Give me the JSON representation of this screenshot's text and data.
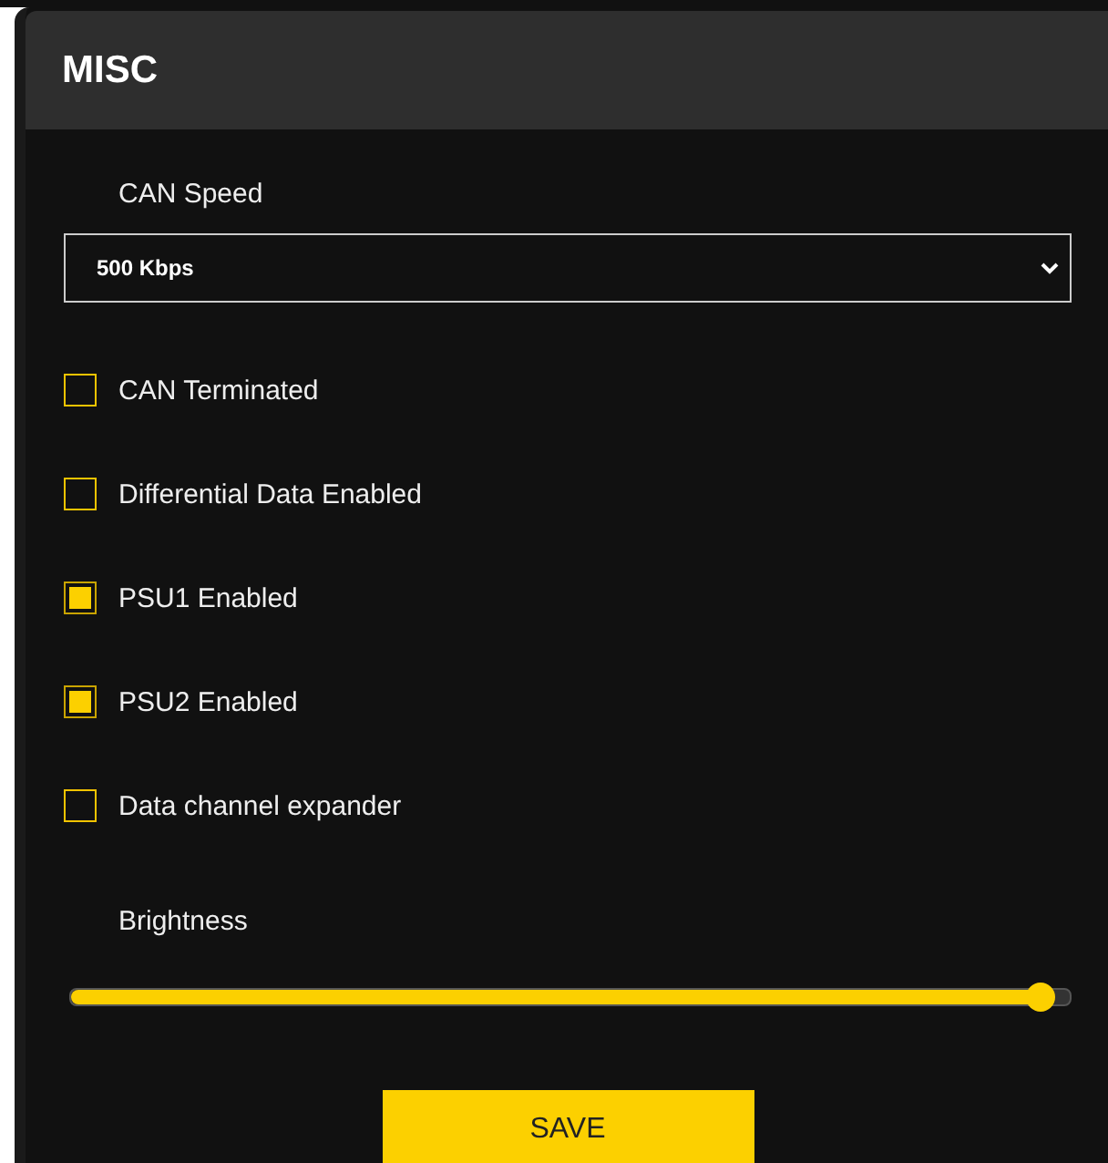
{
  "panel": {
    "title": "MISC"
  },
  "can_speed": {
    "label": "CAN Speed",
    "value": "500 Kbps"
  },
  "options": [
    {
      "label": "CAN Terminated",
      "checked": false
    },
    {
      "label": "Differential Data Enabled",
      "checked": false
    },
    {
      "label": "PSU1 Enabled",
      "checked": true
    },
    {
      "label": "PSU2 Enabled",
      "checked": true
    },
    {
      "label": "Data channel expander",
      "checked": false
    }
  ],
  "brightness": {
    "label": "Brightness",
    "level": 0.97
  },
  "save_button": {
    "label": "SAVE"
  }
}
